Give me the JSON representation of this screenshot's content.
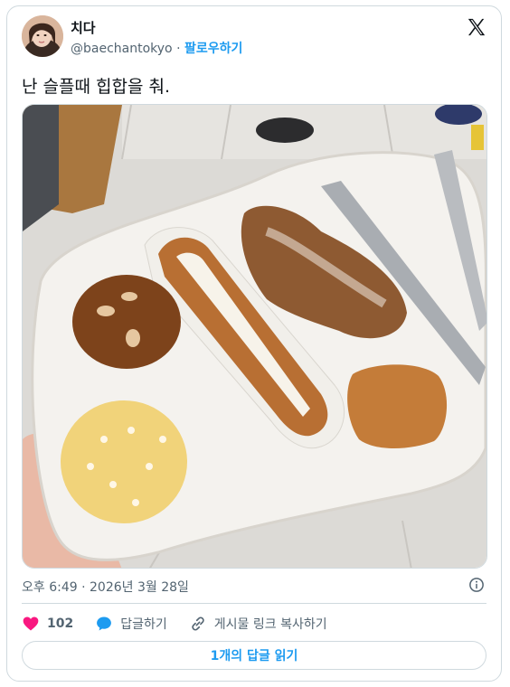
{
  "user": {
    "display_name": "치다",
    "handle": "@baechantokyo",
    "separator": "·",
    "follow_label": "팔로우하기"
  },
  "tweet": {
    "text": "난 슬플때 힙합을 춰.",
    "timestamp": "오후 6:49 · 2026년 3월 28일"
  },
  "actions": {
    "likes_count": "102",
    "reply_label": "답글하기",
    "copy_link_label": "게시물 링크 복사하기"
  },
  "read_replies_label": "1개의 답글 읽기",
  "icons": {
    "logo": "x-logo-icon",
    "heart": "heart-icon",
    "reply": "speech-bubble-icon",
    "link": "link-icon",
    "info": "info-icon"
  },
  "colors": {
    "accent": "#1d9bf0",
    "heart": "#f91880",
    "text": "#0f1419",
    "muted": "#536471",
    "border": "#cfd9de"
  }
}
